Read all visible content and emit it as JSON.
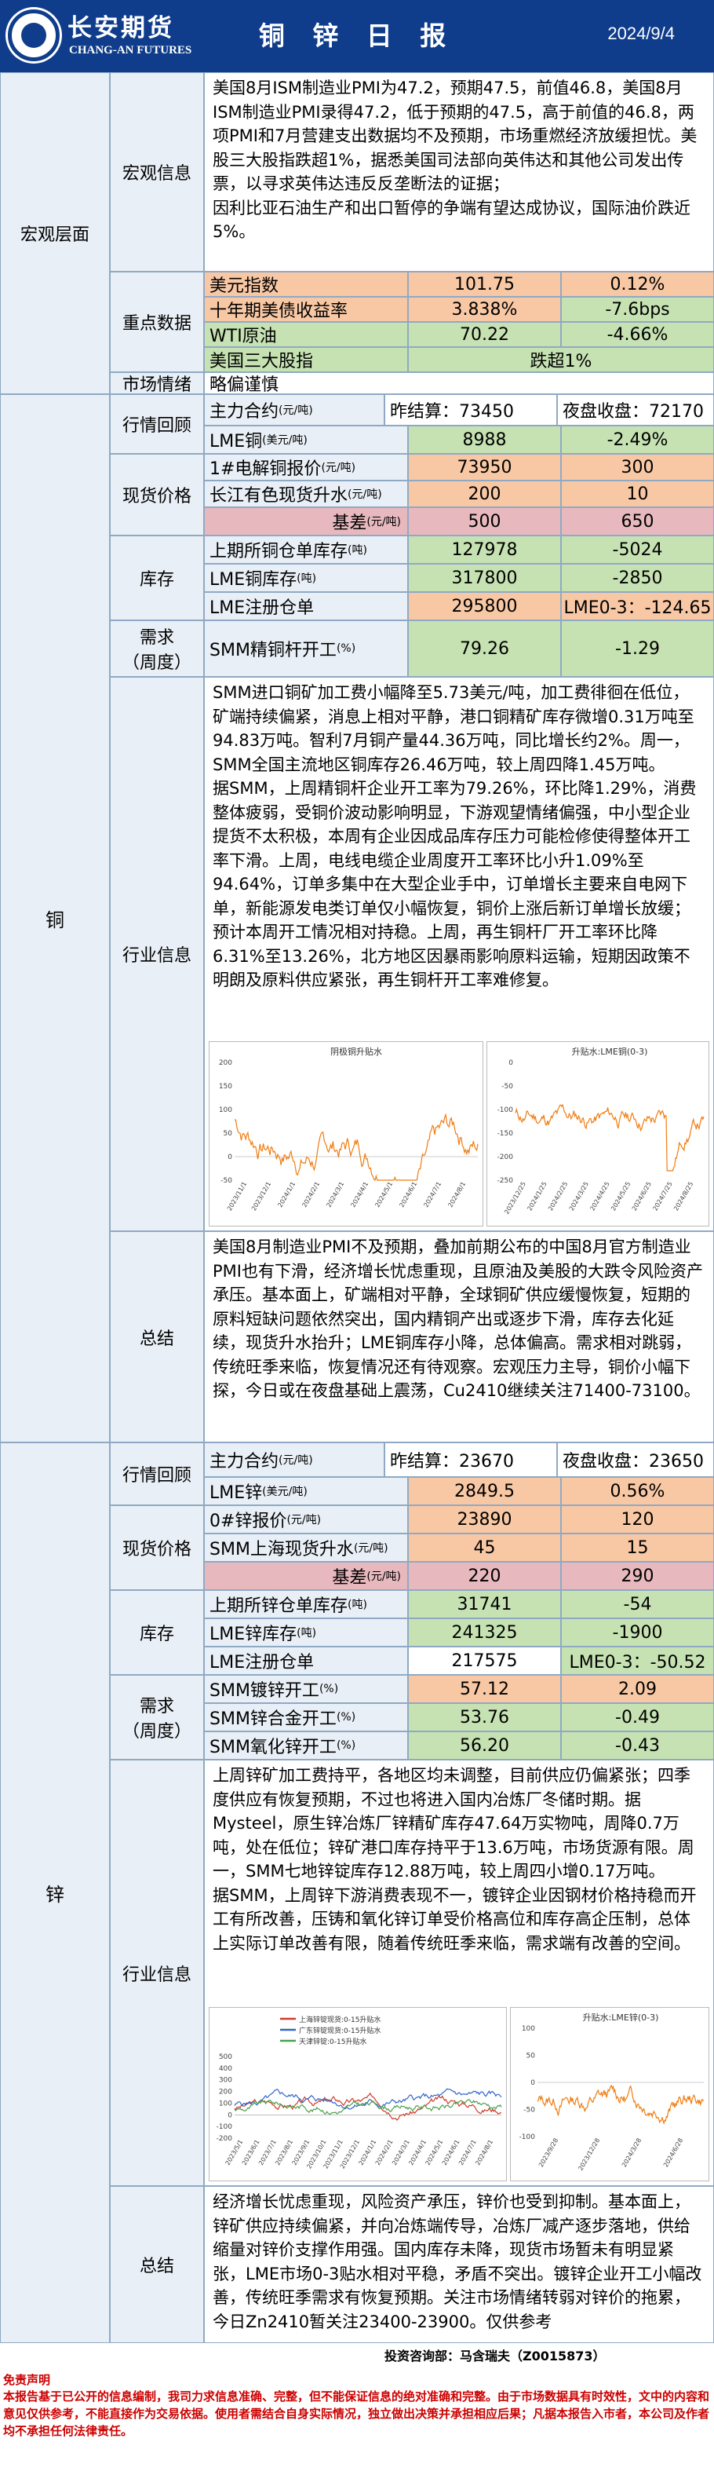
{
  "header": {
    "brand_cn": "长安期货",
    "brand_en": "CHANG-AN FUTURES",
    "title": "铜 锌 日 报",
    "date": "2024/9/4"
  },
  "macro": {
    "section": "宏观层面",
    "info_label": "宏观信息",
    "info_text": [
      "美国8月ISM制造业PMI为47.2，预期47.5，前值46.8，美国8月ISM制造业PMI录得47.2，低于预期的47.5，高于前值的46.8，两项PMI和7月营建支出数据均不及预期，市场重燃经济放缓担忧。美股三大股指跌超1%，据悉美国司法部向英伟达和其他公司发出传票，以寻求英伟达违反反垄断法的证据；",
      "因利比亚石油生产和出口暂停的争端有望达成协议，国际油价跌近5%。"
    ],
    "key_label": "重点数据",
    "key_rows": [
      [
        "美元指数",
        "101.75",
        "0.12%"
      ],
      [
        "十年期美债收益率",
        "3.838%",
        "-7.6bps"
      ],
      [
        "WTI原油",
        "70.22",
        "-4.66%"
      ],
      [
        "美国三大股指",
        "跌超1%"
      ]
    ],
    "mood_label": "市场情绪",
    "mood_value": "略偏谨慎"
  },
  "copper": {
    "section": "铜",
    "review_label": "行情回顾",
    "main_label": "主力合约",
    "main_unit": "(元/吨)",
    "main_prev": "昨结算：73450",
    "main_night": "夜盘收盘：72170",
    "lme_label": "LME铜",
    "lme_unit": "(美元/吨)",
    "lme_value": "8988",
    "lme_change": "-2.49%",
    "spot_label": "现货价格",
    "spot1_label": "1#电解铜报价",
    "spot1_unit": "(元/吨)",
    "spot1_value": "73950",
    "spot1_change": "300",
    "spot2_label": "长江有色现货升水",
    "spot2_unit": "(元/吨)",
    "spot2_value": "200",
    "spot2_change": "10",
    "basis_label": "基差",
    "basis_unit": "(元/吨)",
    "basis_value": "500",
    "basis_change": "650",
    "inv_label": "库存",
    "inv1_label": "上期所铜仓单库存",
    "inv1_unit": "(吨)",
    "inv1_value": "127978",
    "inv1_change": "-5024",
    "inv2_label": "LME铜库存",
    "inv2_unit": "(吨)",
    "inv2_value": "317800",
    "inv2_change": "-2850",
    "inv3_label": "LME注册仓单",
    "inv3_value": "295800",
    "inv3_change": "LME0-3：-124.65",
    "demand_label_1": "需求",
    "demand_label_2": "（周度）",
    "demand1_label": "SMM精铜杆开工",
    "demand1_unit": "(%)",
    "demand1_value": "79.26",
    "demand1_change": "-1.29",
    "industry_label": "行业信息",
    "industry_text": [
      "SMM进口铜矿加工费小幅降至5.73美元/吨，加工费徘徊在低位，矿端持续偏紧，消息上相对平静，港口铜精矿库存微增0.31万吨至94.83万吨。智利7月铜产量44.36万吨，同比增长约2%。周一，SMM全国主流地区铜库存26.46万吨，较上周四降1.45万吨。",
      "据SMM，上周精铜杆企业开工率为79.26%，环比降1.29%，消费整体疲弱，受铜价波动影响明显，下游观望情绪偏强，中小型企业提货不太积极，本周有企业因成品库存压力可能检修使得整体开工率下滑。上周，电线电缆企业周度开工率环比小升1.09%至94.64%，订单多集中在大型企业手中，订单增长主要来自电网下单，新能源发电类订单仅小幅恢复，铜价上涨后新订单增长放缓；预计本周开工情况相对持稳。上周，再生铜杆厂开工率环比降6.31%至13.26%，北方地区因暴雨影响原料运输，短期因政策不明朗及原料供应紧张，再生铜杆开工率难修复。"
    ],
    "chart1": {
      "title": "阴极铜升贴水",
      "ymin": -50,
      "ymax": 200,
      "ticks": [
        200,
        150,
        100,
        50,
        0,
        -50
      ],
      "xlabels": [
        "2023/11/1",
        "2023/12/1",
        "2024/1/1",
        "2024/2/1",
        "2024/3/1",
        "2024/4/1",
        "2024/5/1",
        "2024/6/1",
        "2024/7/1",
        "2024/8/1"
      ]
    },
    "chart2": {
      "title": "升贴水:LME铜(0-3)",
      "ymin": -250,
      "ymax": 0,
      "ticks": [
        0,
        -50,
        -100,
        -150,
        -200,
        -250
      ],
      "xlabels": [
        "2023/12/25",
        "2024/1/25",
        "2024/2/25",
        "2024/3/25",
        "2024/4/25",
        "2024/5/25",
        "2024/6/25",
        "2024/7/25",
        "2024/8/25"
      ]
    },
    "summary_label": "总结",
    "summary_text": "美国8月制造业PMI不及预期，叠加前期公布的中国8月官方制造业PMI也有下滑，经济增长忧虑重现，且原油及美股的大跌令风险资产承压。基本面上，矿端相对平静，全球铜矿供应缓慢恢复，短期的原料短缺问题依然突出，国内精铜产出或逐步下滑，库存去化延续，现货升水抬升；LME铜库存小降，总体偏高。需求相对跳弱，传统旺季来临，恢复情况还有待观察。宏观压力主导，铜价小幅下探，今日或在夜盘基础上震荡，Cu2410继续关注71400-73100。"
  },
  "zinc": {
    "section": "锌",
    "review_label": "行情回顾",
    "main_label": "主力合约",
    "main_unit": "(元/吨)",
    "main_prev": "昨结算：23670",
    "main_night": "夜盘收盘：23650",
    "lme_label": "LME锌",
    "lme_unit": "(美元/吨)",
    "lme_value": "2849.5",
    "lme_change": "0.56%",
    "spot_label": "现货价格",
    "spot1_label": "0#锌报价",
    "spot1_unit": "(元/吨)",
    "spot1_value": "23890",
    "spot1_change": "120",
    "spot2_label": "SMM上海现货升水",
    "spot2_unit": "(元/吨)",
    "spot2_value": "45",
    "spot2_change": "15",
    "basis_label": "基差",
    "basis_unit": "(元/吨)",
    "basis_value": "220",
    "basis_change": "290",
    "inv_label": "库存",
    "inv1_label": "上期所锌仓单库存",
    "inv1_unit": "(吨)",
    "inv1_value": "31741",
    "inv1_change": "-54",
    "inv2_label": "LME锌库存",
    "inv2_unit": "(吨)",
    "inv2_value": "241325",
    "inv2_change": "-1900",
    "inv3_label": "LME注册仓单",
    "inv3_value": "217575",
    "inv3_change": "LME0-3：-50.52",
    "demand_label_1": "需求",
    "demand_label_2": "（周度）",
    "demand1_label": "SMM镀锌开工",
    "demand1_unit": "(%)",
    "demand1_value": "57.12",
    "demand1_change": "2.09",
    "demand2_label": "SMM锌合金开工",
    "demand2_unit": "(%)",
    "demand2_value": "53.76",
    "demand2_change": "-0.49",
    "demand3_label": "SMM氧化锌开工",
    "demand3_unit": "(%)",
    "demand3_value": "56.20",
    "demand3_change": "-0.43",
    "industry_label": "行业信息",
    "industry_text": [
      "上周锌矿加工费持平，各地区均未调整，目前供应仍偏紧张；四季度供应有恢复预期，不过也将进入国内冶炼厂冬储时期。据Mysteel，原生锌冶炼厂锌精矿库存47.64万实物吨，周降0.7万吨，处在低位；锌矿港口库存持平于13.6万吨，市场货源有限。周一，SMM七地锌锭库存12.88万吨，较上周四小增0.17万吨。",
      "据SMM，上周锌下游消费表现不一，镀锌企业因钢材价格持稳而开工有所改善，压铸和氧化锌订单受价格高位和库存高企压制，总体上实际订单改善有限，随着传统旺季来临，需求端有改善的空间。"
    ],
    "chart1": {
      "legend": [
        "上海锌锭现货:0-15升贴水",
        "广东锌锭现货:0-15升贴水",
        "天津锌锭:0-15升贴水"
      ],
      "ymin": -200,
      "ymax": 500,
      "ticks": [
        500,
        400,
        300,
        200,
        100,
        0,
        -100,
        -200
      ],
      "xlabels": [
        "2023/5/1",
        "2023/6/1",
        "2023/7/1",
        "2023/8/1",
        "2023/9/1",
        "2023/10/1",
        "2023/11/1",
        "2023/12/1",
        "2024/1/1",
        "2024/2/1",
        "2024/3/1",
        "2024/4/1",
        "2024/5/1",
        "2024/6/1",
        "2024/7/1",
        "2024/8/1"
      ]
    },
    "chart2": {
      "title": "升贴水:LME锌(0-3)",
      "ymin": -100,
      "ymax": 100,
      "ticks": [
        100,
        50,
        0,
        -50,
        -100
      ],
      "xlabels": [
        "2023/9/28",
        "2023/12/28",
        "2024/3/28",
        "2024/6/28"
      ]
    },
    "summary_label": "总结",
    "summary_text": "经济增长忧虑重现，风险资产承压，锌价也受到抑制。基本面上，锌矿供应持续偏紧，并向冶炼端传导，冶炼厂减产逐步落地，供给缩量对锌价支撑作用强。国内库存未降，现货市场暂未有明显紧张，LME市场0-3贴水相对平稳，矛盾不突出。镀锌企业开工小幅改善，传统旺季需求有恢复预期。关注市场情绪转弱对锌价的拖累，今日Zn2410暂关注23400-23900。仅供参考"
  },
  "footer": {
    "consultant": "投资咨询部：马含瑞夫（Z0015873）",
    "disclaimer_title": "免责声明",
    "disclaimer_text": "本报告基于已公开的信息编制，我司力求信息准确、完整，但不能保证信息的绝对准确和完整。由于市场数据具有时效性，文中的内容和意见仅供参考，不能直接作为交易依据。使用者需结合自身实际情况，独立做出决策并承担相应后果；凡据本报告入市者，本公司及作者均不承担任何法律责任。"
  },
  "colors": {
    "header": "#0f3d8b",
    "label_bg": "#e9eff6",
    "orange": "#f8c8a5",
    "green": "#c6e2b3",
    "pink": "#e7b9be",
    "disclaimer": "#cc0000"
  }
}
